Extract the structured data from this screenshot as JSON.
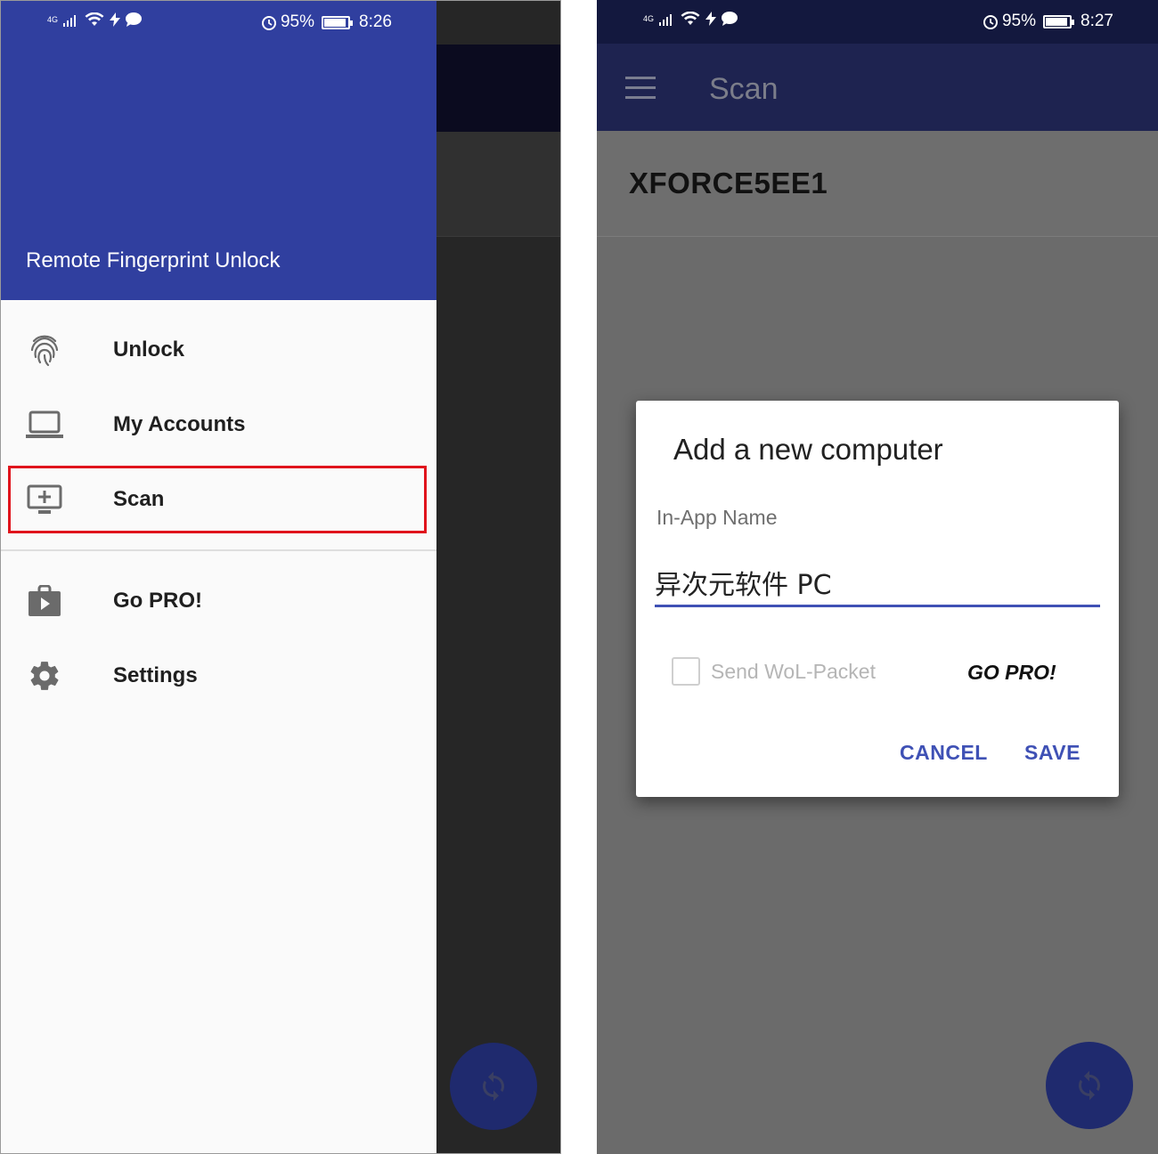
{
  "left_screen": {
    "status_bar": {
      "network": "4G",
      "battery": "95%",
      "time": "8:26"
    },
    "drawer": {
      "app_title": "Remote Fingerprint Unlock",
      "items": [
        {
          "label": "Unlock",
          "icon": "fingerprint-icon"
        },
        {
          "label": "My Accounts",
          "icon": "laptop-icon"
        },
        {
          "label": "Scan",
          "icon": "add-to-screen-icon",
          "highlighted": true
        },
        {
          "label": "Go PRO!",
          "icon": "shop-icon"
        },
        {
          "label": "Settings",
          "icon": "gear-icon"
        }
      ]
    },
    "fab_icon": "refresh-icon"
  },
  "right_screen": {
    "status_bar": {
      "network": "4G",
      "battery": "95%",
      "time": "8:27"
    },
    "appbar": {
      "title": "Scan",
      "menu_icon": "hamburger-menu-icon"
    },
    "device": {
      "name": "XFORCE5EE1"
    },
    "dialog": {
      "title": "Add a new computer",
      "field_label": "In-App Name",
      "field_value": "异次元软件 PC",
      "wol_label": "Send WoL-Packet",
      "go_pro_label": "GO PRO!",
      "cancel_label": "CANCEL",
      "save_label": "SAVE"
    },
    "fab_icon": "refresh-icon"
  },
  "colors": {
    "drawer_header": "#303f9f",
    "accent": "#3f51b5",
    "highlight_border": "#e0141c",
    "fab": "#1f2a6e"
  }
}
